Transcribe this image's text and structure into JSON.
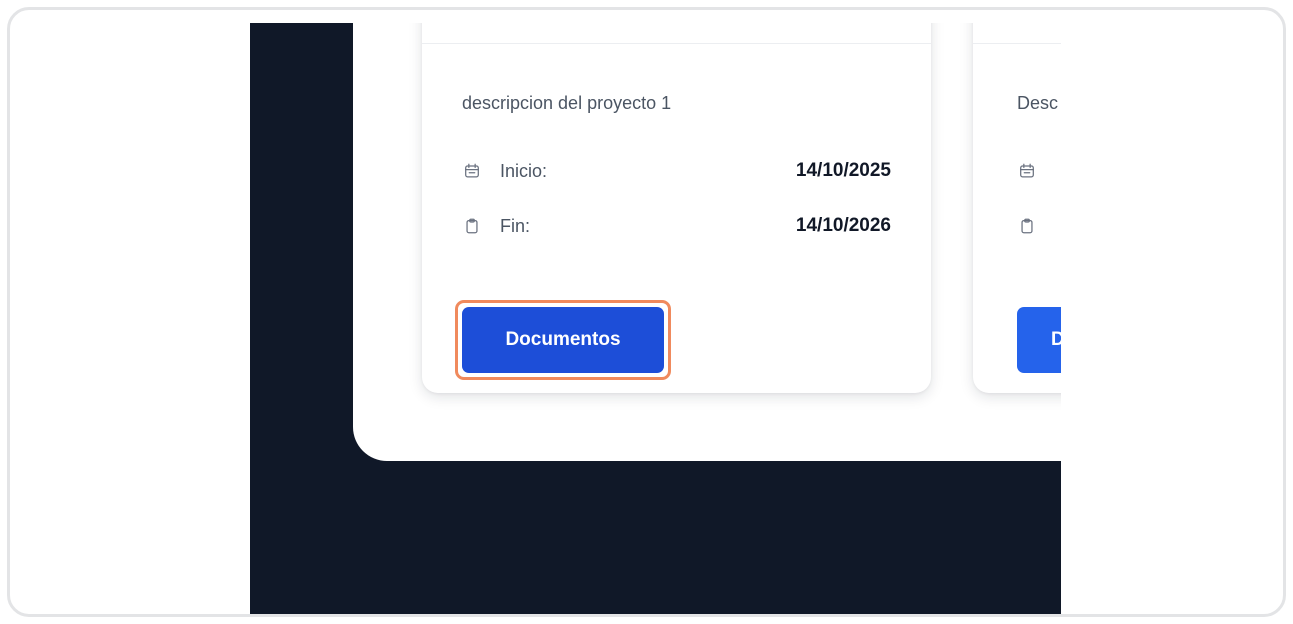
{
  "project_cards": [
    {
      "description": "descripcion del proyecto 1",
      "start_label": "Inicio:",
      "start_date": "14/10/2025",
      "end_label": "Fin:",
      "end_date": "14/10/2026",
      "button_label": "Documentos",
      "start_icon": "calendar-icon",
      "end_icon": "clipboard-icon"
    },
    {
      "description_visible": "Desc",
      "button_label_visible": "D",
      "start_icon": "calendar-icon",
      "end_icon": "clipboard-icon"
    }
  ],
  "colors": {
    "page_background": "#101828",
    "button_primary": "#1d4ed8",
    "button_secondary": "#2563eb",
    "highlight": "#f08a5d"
  }
}
